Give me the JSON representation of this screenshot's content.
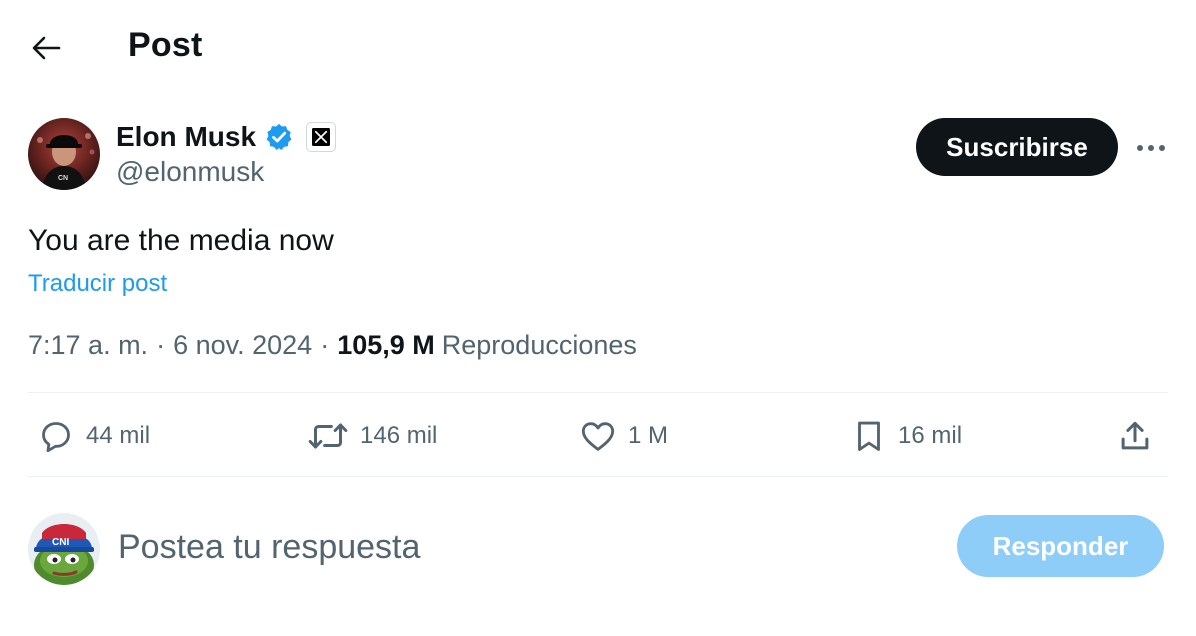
{
  "header": {
    "title": "Post",
    "back_icon": "arrow-left-icon"
  },
  "author": {
    "name": "Elon Musk",
    "handle": "@elonmusk",
    "verified_icon": "verified-badge-icon",
    "affiliate_icon": "x-logo-icon"
  },
  "actions_top": {
    "subscribe_label": "Suscribirse",
    "more_icon": "more-horizontal-icon"
  },
  "post": {
    "text": "You are the media now",
    "translate_label": "Traducir post",
    "time": "7:17 a. m.",
    "separator": "·",
    "date": "6 nov. 2024",
    "views_count": "105,9 M",
    "views_label": "Reproducciones"
  },
  "stats": {
    "replies": "44 mil",
    "reposts": "146 mil",
    "likes": "1 M",
    "bookmarks": "16 mil"
  },
  "reply": {
    "placeholder": "Postea tu respuesta",
    "button_label": "Responder"
  },
  "colors": {
    "accent": "#1d9bf0",
    "text": "#0f1419",
    "muted": "#536471",
    "reply_button_disabled": "#8ecdf8",
    "divider": "#eff3f4"
  }
}
